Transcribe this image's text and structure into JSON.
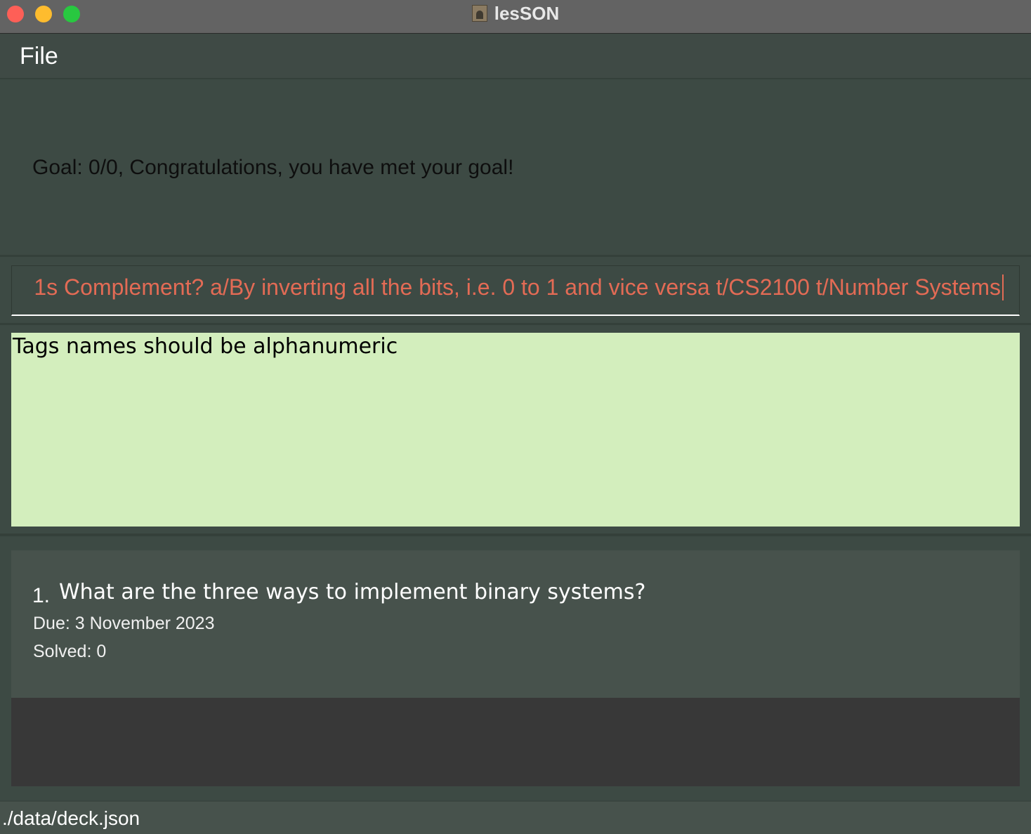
{
  "window": {
    "title": "lesSON",
    "icon": "app-person-icon"
  },
  "menu": {
    "file_label": "File"
  },
  "goal": {
    "text": "Goal: 0/0, Congratulations, you have met your goal!"
  },
  "command": {
    "value": "1s Complement? a/By inverting all the bits, i.e. 0 to 1 and vice versa t/CS2100 t/Number Systems"
  },
  "result": {
    "message": "Tags names should be alphanumeric"
  },
  "cards": [
    {
      "index": "1.",
      "question": "What are the three ways to implement binary systems?",
      "due": "Due: 3 November 2023",
      "solved": "Solved: 0"
    }
  ],
  "status": {
    "path": "./data/deck.json"
  },
  "colors": {
    "command_text": "#e36b55",
    "result_bg": "#d3eebd",
    "background": "#3d4a44"
  }
}
